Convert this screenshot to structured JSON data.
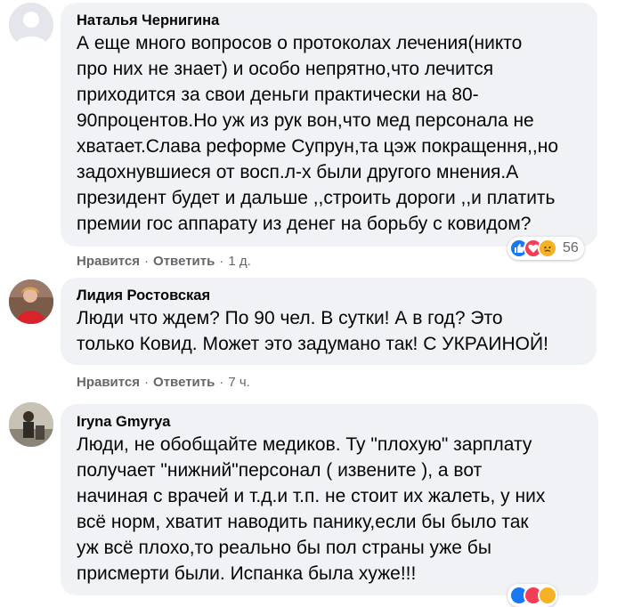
{
  "comments": [
    {
      "author": "Наталья Чернигина",
      "text": "А еще много вопросов о протоколах лечения(никто\nпро них не знает) и особо непрятно,что лечится\nприходится за свои деньги практически на 80-\n90процентов.Но уж из рук вон,что мед персонала не\nхватает.Слава реформе Супрун,та цэж покращення,,но\nзадохнувшиеся от восп.л-х были другого мнения.А\nпрезидент будет и дальше ,,строить дороги ,,и платить\nпремии гос аппарату из денег на борьбу с ковидом?",
      "like_label": "Нравится",
      "reply_label": "Ответить",
      "time": "1 д.",
      "reactions": [
        "like-icon",
        "love-icon",
        "sad-icon"
      ],
      "reaction_count": "56"
    },
    {
      "author": "Лидия Ростовская",
      "text": "Люди что ждем? По 90 чел. В сутки! А в год? Это\nтолько Ковид. Может это задумано так! С УКРАИНОЙ!",
      "like_label": "Нравится",
      "reply_label": "Ответить",
      "time": "7 ч."
    },
    {
      "author": "Iryna Gmyrya",
      "text": "Люди, не обобщайте медиков. Ту \"плохую\" зарплату\nполучает \"нижний\"персонал ( извените ), а вот\nначиная с врачей и т.д.и т.п. не стоит их жалеть, у них\nвсё норм, хватит наводить панику,если бы было так\nуж всё плохо,то реально бы пол страны уже бы\nприсмерти были. Испанка была хуже!!!",
      "reactions": [
        "like-icon",
        "love-icon",
        "sad-icon"
      ]
    }
  ],
  "separator": "·",
  "colors": {
    "bubble": "#f0f2f5",
    "meta_text": "#65676b",
    "like": "#1877f2",
    "love": "#f33e58",
    "sad": "#f7b125"
  }
}
